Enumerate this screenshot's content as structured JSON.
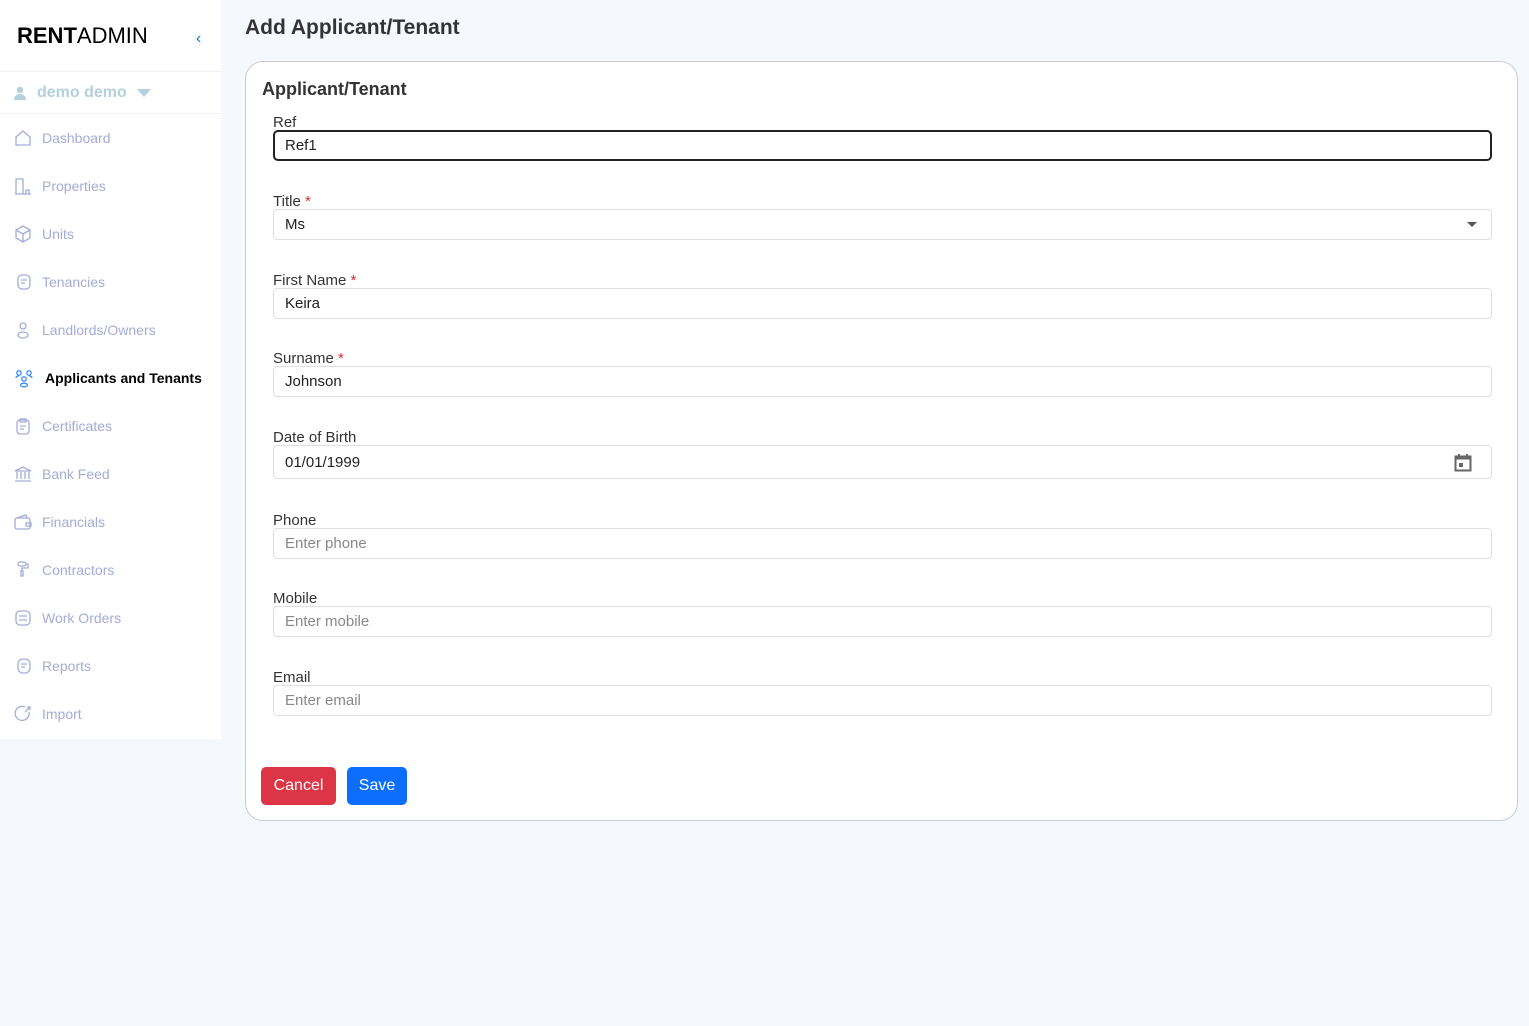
{
  "brand": {
    "bold": "RENT",
    "rest": "ADMIN"
  },
  "user": {
    "name": "demo demo"
  },
  "nav": [
    {
      "label": "Dashboard",
      "icon": "home-icon"
    },
    {
      "label": "Properties",
      "icon": "building-icon"
    },
    {
      "label": "Units",
      "icon": "cube-icon"
    },
    {
      "label": "Tenancies",
      "icon": "document-icon"
    },
    {
      "label": "Landlords/Owners",
      "icon": "person-icon"
    },
    {
      "label": "Applicants and Tenants",
      "icon": "group-icon",
      "active": true
    },
    {
      "label": "Certificates",
      "icon": "clipboard-icon"
    },
    {
      "label": "Bank Feed",
      "icon": "bank-icon"
    },
    {
      "label": "Financials",
      "icon": "wallet-icon"
    },
    {
      "label": "Contractors",
      "icon": "paint-roller-icon"
    },
    {
      "label": "Work Orders",
      "icon": "list-icon"
    },
    {
      "label": "Reports",
      "icon": "report-icon"
    },
    {
      "label": "Import",
      "icon": "import-icon"
    }
  ],
  "page_title": "Add Applicant/Tenant",
  "form": {
    "title": "Applicant/Tenant",
    "fields": [
      {
        "label": "Ref",
        "value": "Ref1",
        "required": false
      },
      {
        "label": "Title",
        "value": "Ms",
        "required": true
      },
      {
        "label": "First Name",
        "value": "Keira",
        "required": true
      },
      {
        "label": "Surname",
        "value": "Johnson",
        "required": true
      },
      {
        "label": "Date of Birth",
        "value": "01/01/1999",
        "required": false
      },
      {
        "label": "Phone",
        "placeholder": "Enter phone",
        "required": false
      },
      {
        "label": "Mobile",
        "placeholder": "Enter mobile",
        "required": false
      },
      {
        "label": "Email",
        "placeholder": "Enter email",
        "required": false
      }
    ],
    "required_mark": "*",
    "cancel": "Cancel",
    "save": "Save"
  },
  "colors": {
    "cancel": "#dc3545",
    "save": "#0d6efd",
    "accent": "#3b8ef0"
  }
}
